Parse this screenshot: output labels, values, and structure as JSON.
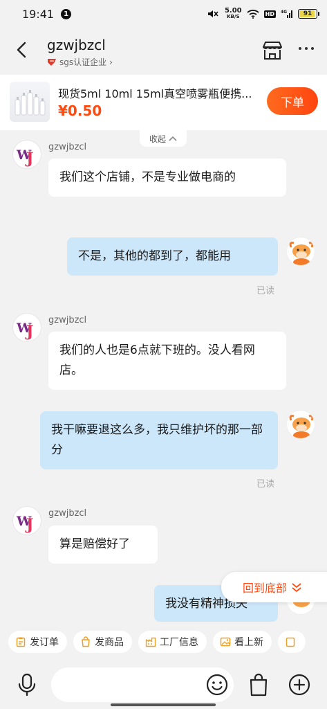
{
  "status_bar": {
    "time": "19:41",
    "notification_count": "1",
    "network_speed": "5.00",
    "network_unit": "KB/S",
    "hd": "HD",
    "signal_label": "4G",
    "battery": "91"
  },
  "header": {
    "shop_name": "gzwjbzcl",
    "cert_label": "sgs认证企业",
    "cert_chevron": "›"
  },
  "product": {
    "title": "现货5ml 10ml 15ml真空喷雾瓶便携...",
    "price": "¥0.50",
    "order_button": "下单"
  },
  "collapse_label": "收起",
  "messages": [
    {
      "side": "in",
      "sender": "gzwjbzcl",
      "text": "我们这个店铺，不是专业做电商的"
    },
    {
      "side": "out",
      "text": "不是，其他的都到了，都能用",
      "status": "已读"
    },
    {
      "side": "in",
      "sender": "gzwjbzcl",
      "text": "我们的人也是6点就下班的。没人看网店。"
    },
    {
      "side": "out",
      "text": "我干嘛要退这么多，我只维护坏的那一部分",
      "status": "已读"
    },
    {
      "side": "in",
      "sender": "gzwjbzcl",
      "text": "算是赔偿好了"
    },
    {
      "side": "out",
      "text": "我没有精神损失"
    }
  ],
  "scroll_to_bottom": "回到底部",
  "quick_actions": [
    {
      "label": "发订单",
      "icon": "clipboard-icon"
    },
    {
      "label": "发商品",
      "icon": "bag-icon"
    },
    {
      "label": "工厂信息",
      "icon": "factory-icon"
    },
    {
      "label": "看上新",
      "icon": "image-icon"
    }
  ],
  "input": {
    "placeholder": ""
  },
  "colors": {
    "accent": "#ff4a10",
    "bubble_out": "#cde7fa",
    "quick_icon": "#f0a020"
  }
}
